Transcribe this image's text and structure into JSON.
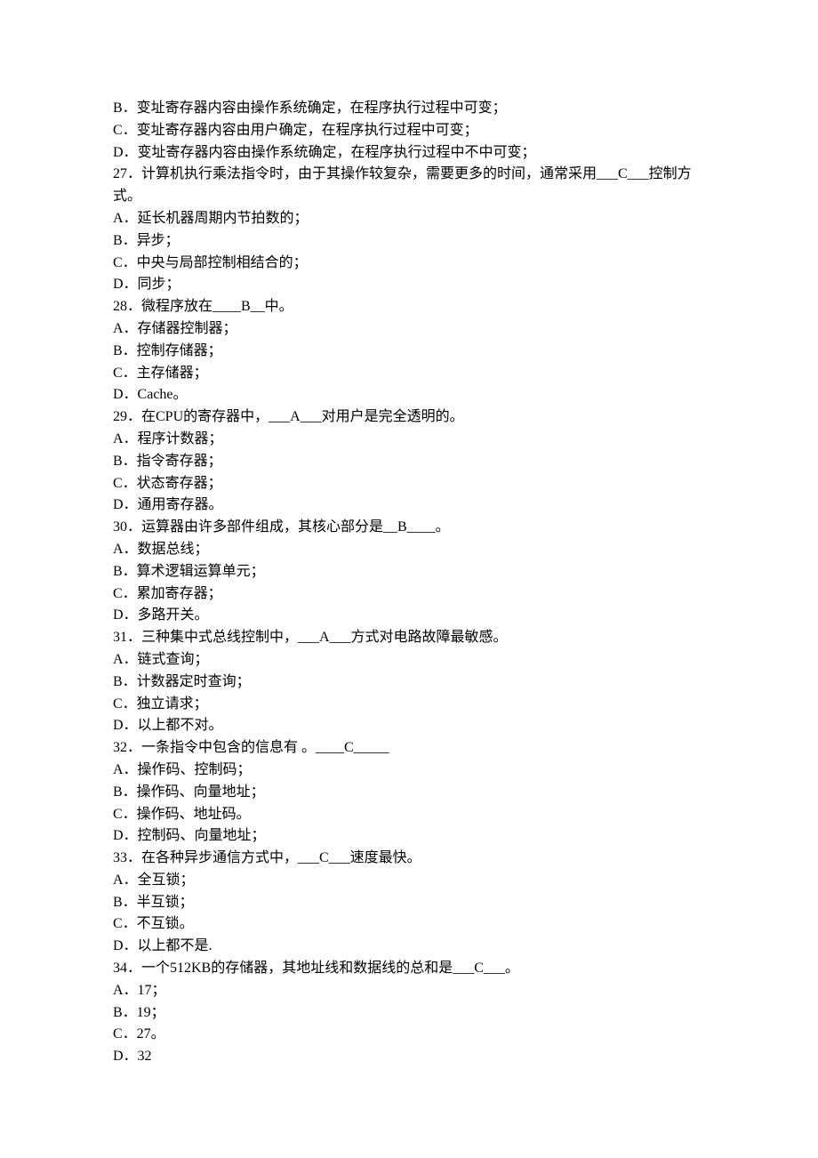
{
  "lines": [
    "B．变址寄存器内容由操作系统确定，在程序执行过程中可变；",
    "C．变址寄存器内容由用户确定，在程序执行过程中可变；",
    "D．变址寄存器内容由操作系统确定，在程序执行过程中不中可变；",
    "27．计算机执行乘法指令时，由于其操作较复杂，需要更多的时间，通常采用___C___控制方式。",
    "A．延长机器周期内节拍数的；",
    "B．异步；",
    "C．中央与局部控制相结合的；",
    "D．同步；",
    "28．微程序放在____B__中。",
    "A．存储器控制器；",
    "B．控制存储器；",
    "C．主存储器；",
    "D．Cache。",
    "29．在CPU的寄存器中，___A___对用户是完全透明的。",
    "A．程序计数器；",
    "B．指令寄存器；",
    "C．状态寄存器；",
    "D．通用寄存器。",
    "30．运算器由许多部件组成，其核心部分是__B____。",
    "A．数据总线；",
    "B．算术逻辑运算单元；",
    "C．累加寄存器；",
    "D．多路开关。",
    "31．三种集中式总线控制中，___A___方式对电路故障最敏感。",
    "A．链式查询；",
    "B．计数器定时查询；",
    "C．独立请求；",
    "D．以上都不对。",
    "32．一条指令中包含的信息有 。____C_____",
    "A．操作码、控制码；",
    "B．操作码、向量地址；",
    "C．操作码、地址码。",
    "D．控制码、向量地址；",
    "33．在各种异步通信方式中，___C___速度最快。",
    "A．全互锁；",
    "B．半互锁；",
    "C．不互锁。",
    "D．以上都不是.",
    "34．一个512KB的存储器，其地址线和数据线的总和是___C___。",
    "A．17；",
    "B．19；",
    "C．27。",
    "D．32"
  ]
}
